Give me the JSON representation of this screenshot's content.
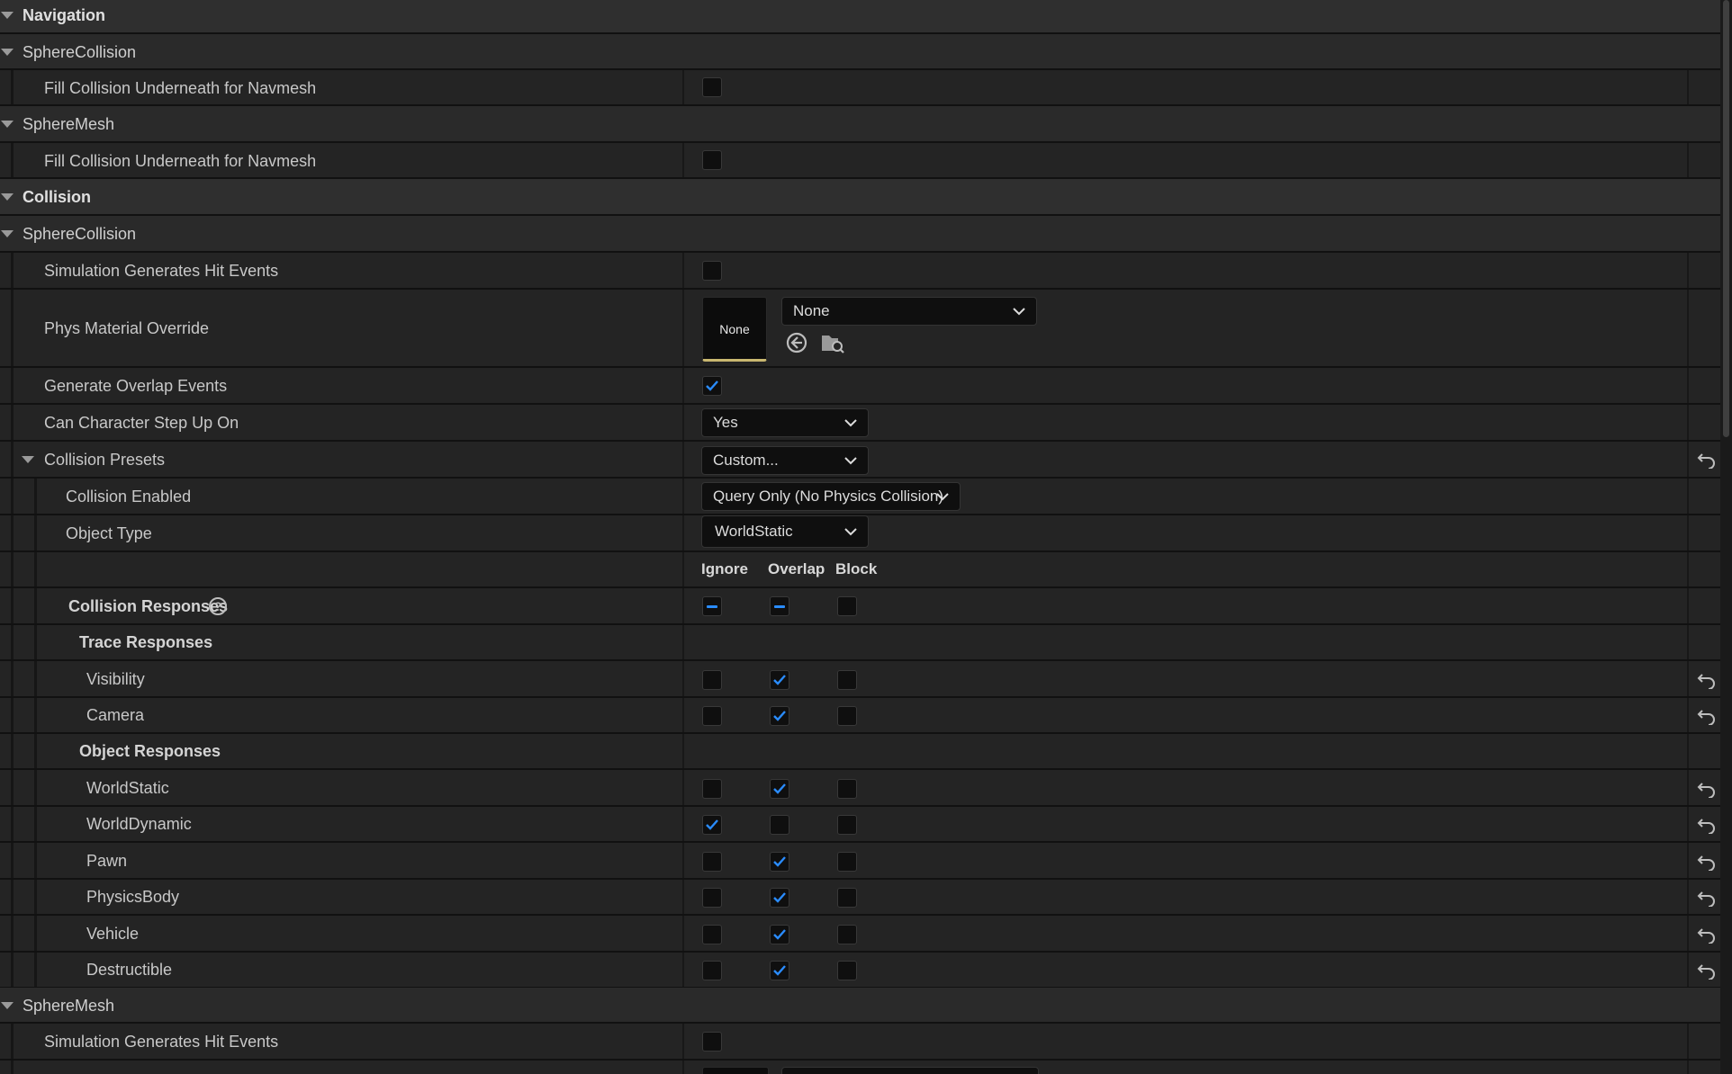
{
  "categories": {
    "navigation": "Navigation",
    "collision": "Collision"
  },
  "components": {
    "sphere_collision": "SphereCollision",
    "sphere_mesh": "SphereMesh"
  },
  "props": {
    "fill_collision": "Fill Collision Underneath for Navmesh",
    "sim_hit_events": "Simulation Generates Hit Events",
    "phys_material_override": "Phys Material Override",
    "generate_overlap_events": "Generate Overlap Events",
    "can_step_up": "Can Character Step Up On",
    "collision_presets": "Collision Presets",
    "collision_enabled": "Collision Enabled",
    "object_type": "Object Type",
    "collision_responses": "Collision Responses",
    "trace_responses": "Trace Responses",
    "object_responses": "Object Responses"
  },
  "values": {
    "phys_material_thumb": "None",
    "phys_material_dropdown": "None",
    "can_step_up": "Yes",
    "collision_presets": "Custom...",
    "collision_enabled": "Query Only (No Physics Collision)",
    "object_type": "WorldStatic"
  },
  "response_columns": [
    "Ignore",
    "Overlap",
    "Block"
  ],
  "trace_channels": [
    {
      "name": "Visibility",
      "state": "overlap"
    },
    {
      "name": "Camera",
      "state": "overlap"
    }
  ],
  "object_channels": [
    {
      "name": "WorldStatic",
      "state": "overlap"
    },
    {
      "name": "WorldDynamic",
      "state": "ignore"
    },
    {
      "name": "Pawn",
      "state": "overlap"
    },
    {
      "name": "PhysicsBody",
      "state": "overlap"
    },
    {
      "name": "Vehicle",
      "state": "overlap"
    },
    {
      "name": "Destructible",
      "state": "overlap"
    }
  ],
  "checkbox_states": {
    "sphere_collision_fill_nav": false,
    "sphere_mesh_fill_nav": false,
    "sphere_collision_sim_hit": false,
    "generate_overlap": true,
    "sphere_mesh_sim_hit": false
  },
  "icons": {
    "expand": "triangle-down-icon",
    "dropdown": "chevron-down-icon",
    "reset": "reset-to-default-icon",
    "use_selected": "use-selected-asset-icon",
    "browse": "browse-asset-icon",
    "help": "help-icon"
  },
  "colors": {
    "accent": "#2a8cff",
    "thumb_underline": "#c9b870",
    "panel_bg": "#242424"
  }
}
